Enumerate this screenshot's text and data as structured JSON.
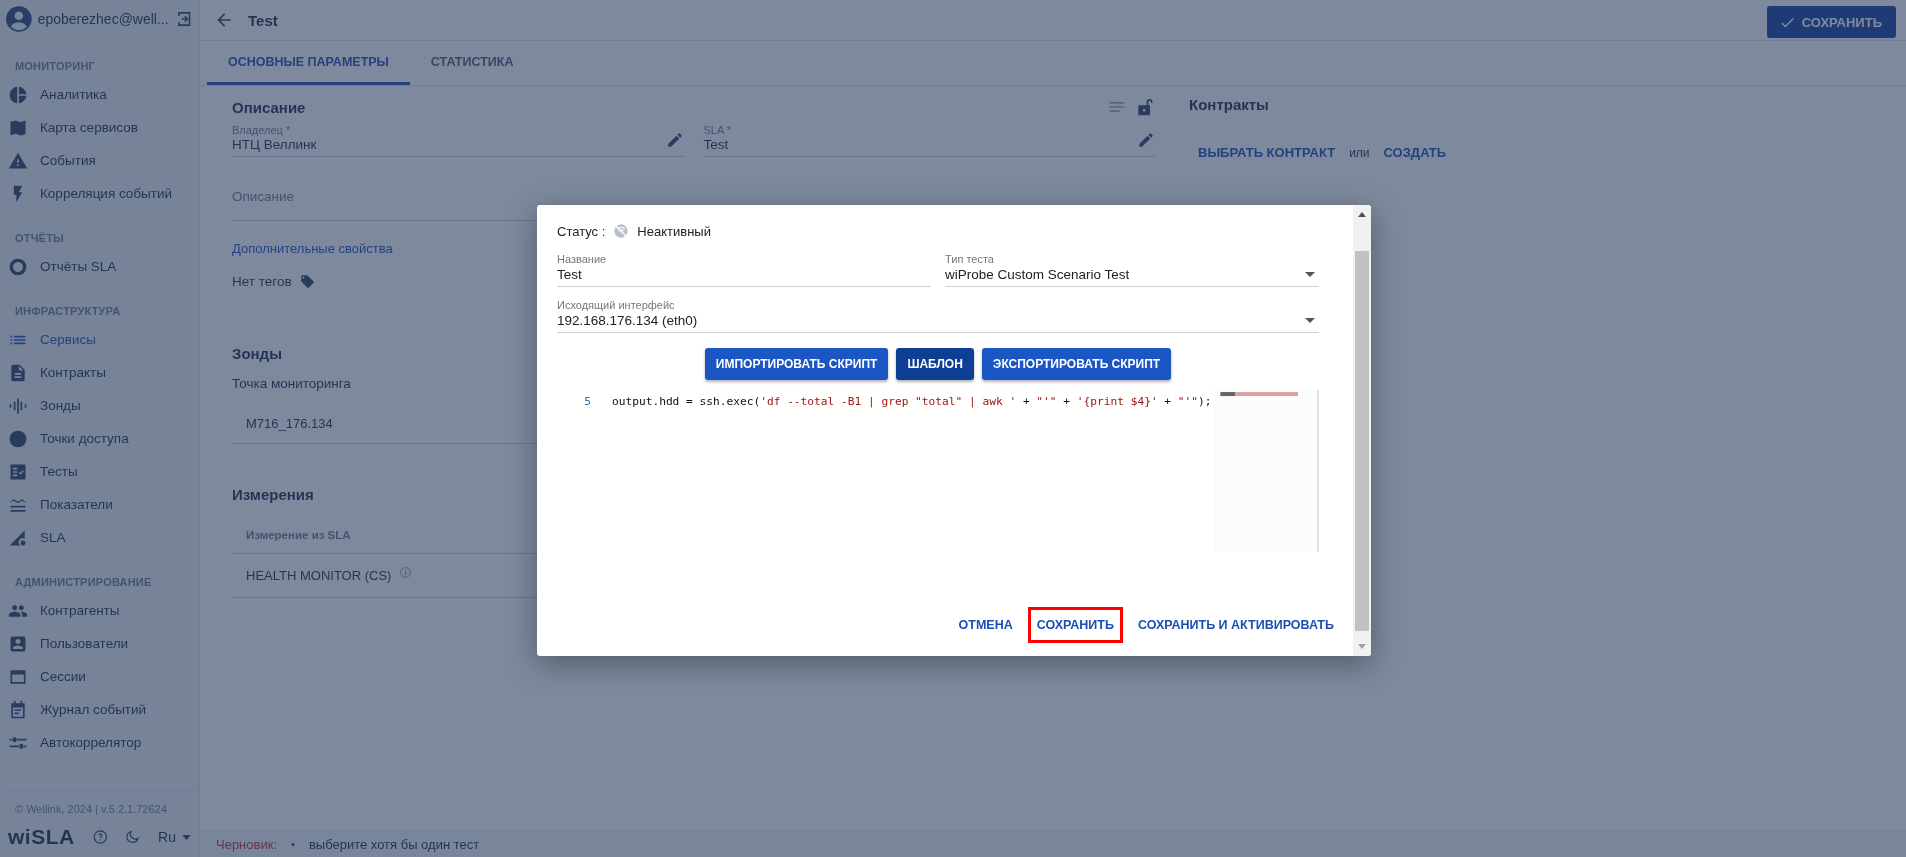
{
  "sidebar": {
    "user": "epoberezhec@well...",
    "sections": [
      {
        "title": "МОНИТОРИНГ",
        "items": [
          {
            "label": "Аналитика",
            "selected": false
          },
          {
            "label": "Карта сервисов",
            "selected": false
          },
          {
            "label": "События",
            "selected": false
          },
          {
            "label": "Корреляция событий",
            "selected": false
          }
        ]
      },
      {
        "title": "ОТЧЁТЫ",
        "items": [
          {
            "label": "Отчёты SLA",
            "selected": false
          }
        ]
      },
      {
        "title": "ИНФРАСТРУКТУРА",
        "items": [
          {
            "label": "Сервисы",
            "selected": true
          },
          {
            "label": "Контракты",
            "selected": false
          },
          {
            "label": "Зонды",
            "selected": false
          },
          {
            "label": "Точки доступа",
            "selected": false
          },
          {
            "label": "Тесты",
            "selected": false
          },
          {
            "label": "Показатели",
            "selected": false
          },
          {
            "label": "SLA",
            "selected": false
          }
        ]
      },
      {
        "title": "АДМИНИСТРИРОВАНИЕ",
        "items": [
          {
            "label": "Контрагенты",
            "selected": false
          },
          {
            "label": "Пользователи",
            "selected": false
          },
          {
            "label": "Сессии",
            "selected": false
          },
          {
            "label": "Журнал событий",
            "selected": false
          },
          {
            "label": "Автокоррелятор",
            "selected": false
          }
        ]
      }
    ],
    "copyright": "© Wellink, 2024 | v.5.2.1.72624",
    "logo": "wiSLA",
    "language": "Ru"
  },
  "header": {
    "title": "Test",
    "save_button": "СОХРАНИТЬ"
  },
  "tabs": [
    {
      "label": "ОСНОВНЫЕ ПАРАМЕТРЫ",
      "selected": true
    },
    {
      "label": "СТАТИСТИКА",
      "selected": false
    }
  ],
  "description": {
    "title": "Описание",
    "fields": [
      {
        "label": "Владелец *",
        "value": "НТЦ Веллинк"
      },
      {
        "label": "SLA *",
        "value": "Test"
      }
    ],
    "description_placeholder": "Описание",
    "extra_link": "Дополнительные свойства",
    "tags": "Нет тегов"
  },
  "probes": {
    "title": "Зонды",
    "label": "Точка мониторинга",
    "rows": [
      "M716_176.134"
    ]
  },
  "measurements": {
    "title": "Измерения",
    "column": "Измерение из SLA",
    "rows": [
      "HEALTH MONITOR (CS)"
    ]
  },
  "contracts": {
    "title": "Контракты",
    "choose": "ВЫБРАТЬ КОНТРАКТ",
    "or": "или",
    "create": "СОЗДАТЬ"
  },
  "status_bar": {
    "label": "Черновик:",
    "bullet": "•",
    "message": "выберите хотя бы один тест"
  },
  "dialog": {
    "status_label": "Статус :",
    "status": "Неактивный",
    "fields": [
      {
        "label": "Название",
        "value": "Test",
        "kind": "text"
      },
      {
        "label": "Тип теста",
        "value": "wiProbe Custom Scenario Test",
        "kind": "select"
      }
    ],
    "interface": {
      "label": "Исходящий интерфейс",
      "value": "192.168.176.134 (eth0)",
      "kind": "select"
    },
    "actions": [
      {
        "label": "ИМПОРТИРОВАТЬ СКРИПТ",
        "focused": false
      },
      {
        "label": "ШАБЛОН",
        "focused": true
      },
      {
        "label": "ЭКСПОРТИРОВАТЬ СКРИПТ",
        "focused": false
      }
    ],
    "code": [
      {
        "number": "5",
        "tokens": [
          {
            "text": "output.hdd = ssh.exec(",
            "kind": "code"
          },
          {
            "text": "'df --total -B1 | grep \"total\" | awk '",
            "kind": "string"
          },
          {
            "text": " + ",
            "kind": "code"
          },
          {
            "text": "\"'\"",
            "kind": "string"
          },
          {
            "text": " + ",
            "kind": "code"
          },
          {
            "text": "'{print $4}'",
            "kind": "string"
          },
          {
            "text": " + ",
            "kind": "code"
          },
          {
            "text": "\"'\"",
            "kind": "string"
          },
          {
            "text": ");",
            "kind": "code"
          }
        ]
      }
    ],
    "buttons": [
      {
        "label": "ОТМЕНА",
        "highlighted": false
      },
      {
        "label": "СОХРАНИТЬ",
        "highlighted": true
      },
      {
        "label": "СОХРАНИТЬ И АКТИВИРОВАТЬ",
        "highlighted": false
      }
    ]
  }
}
